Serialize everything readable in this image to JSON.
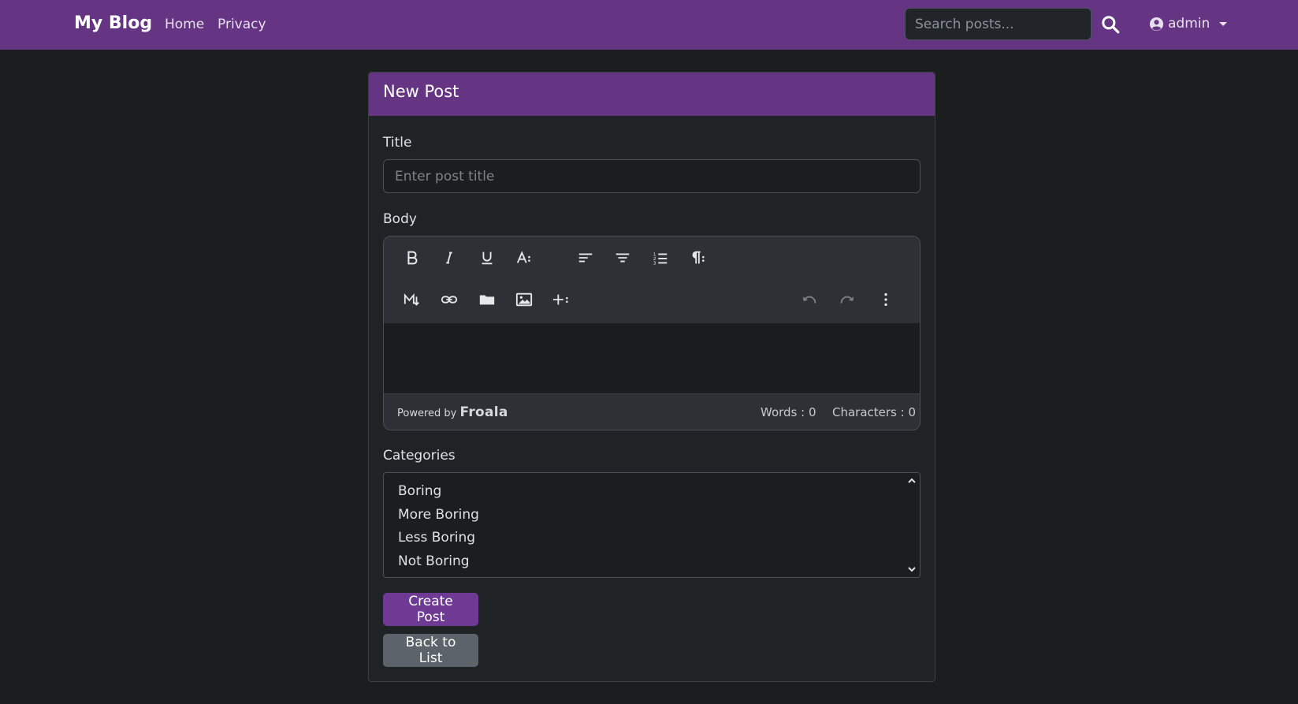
{
  "navbar": {
    "brand": "My Blog",
    "links": [
      "Home",
      "Privacy"
    ],
    "search_placeholder": "Search posts...",
    "user": "admin",
    "color": "#653584"
  },
  "card": {
    "title": "New Post",
    "title_label": "Title",
    "title_placeholder": "Enter post title",
    "body_label": "Body",
    "categories_label": "Categories"
  },
  "editor": {
    "toolbar_row1": [
      "bold-icon",
      "italic-icon",
      "underline-icon",
      "font-size-icon",
      "align-left-icon",
      "align-center-icon",
      "ordered-list-icon",
      "paragraph-format-icon"
    ],
    "toolbar_row2": [
      "markdown-icon",
      "link-icon",
      "folder-icon",
      "image-icon",
      "insert-more-icon",
      "undo-icon",
      "redo-icon",
      "more-icon"
    ],
    "powered_by": "Powered by",
    "brand": "Froala",
    "words": "Words : 0",
    "characters": "Characters : 0"
  },
  "categories": [
    "Boring",
    "More Boring",
    "Less Boring",
    "Not Boring"
  ],
  "buttons": {
    "create": "Create Post",
    "back": "Back to List"
  }
}
